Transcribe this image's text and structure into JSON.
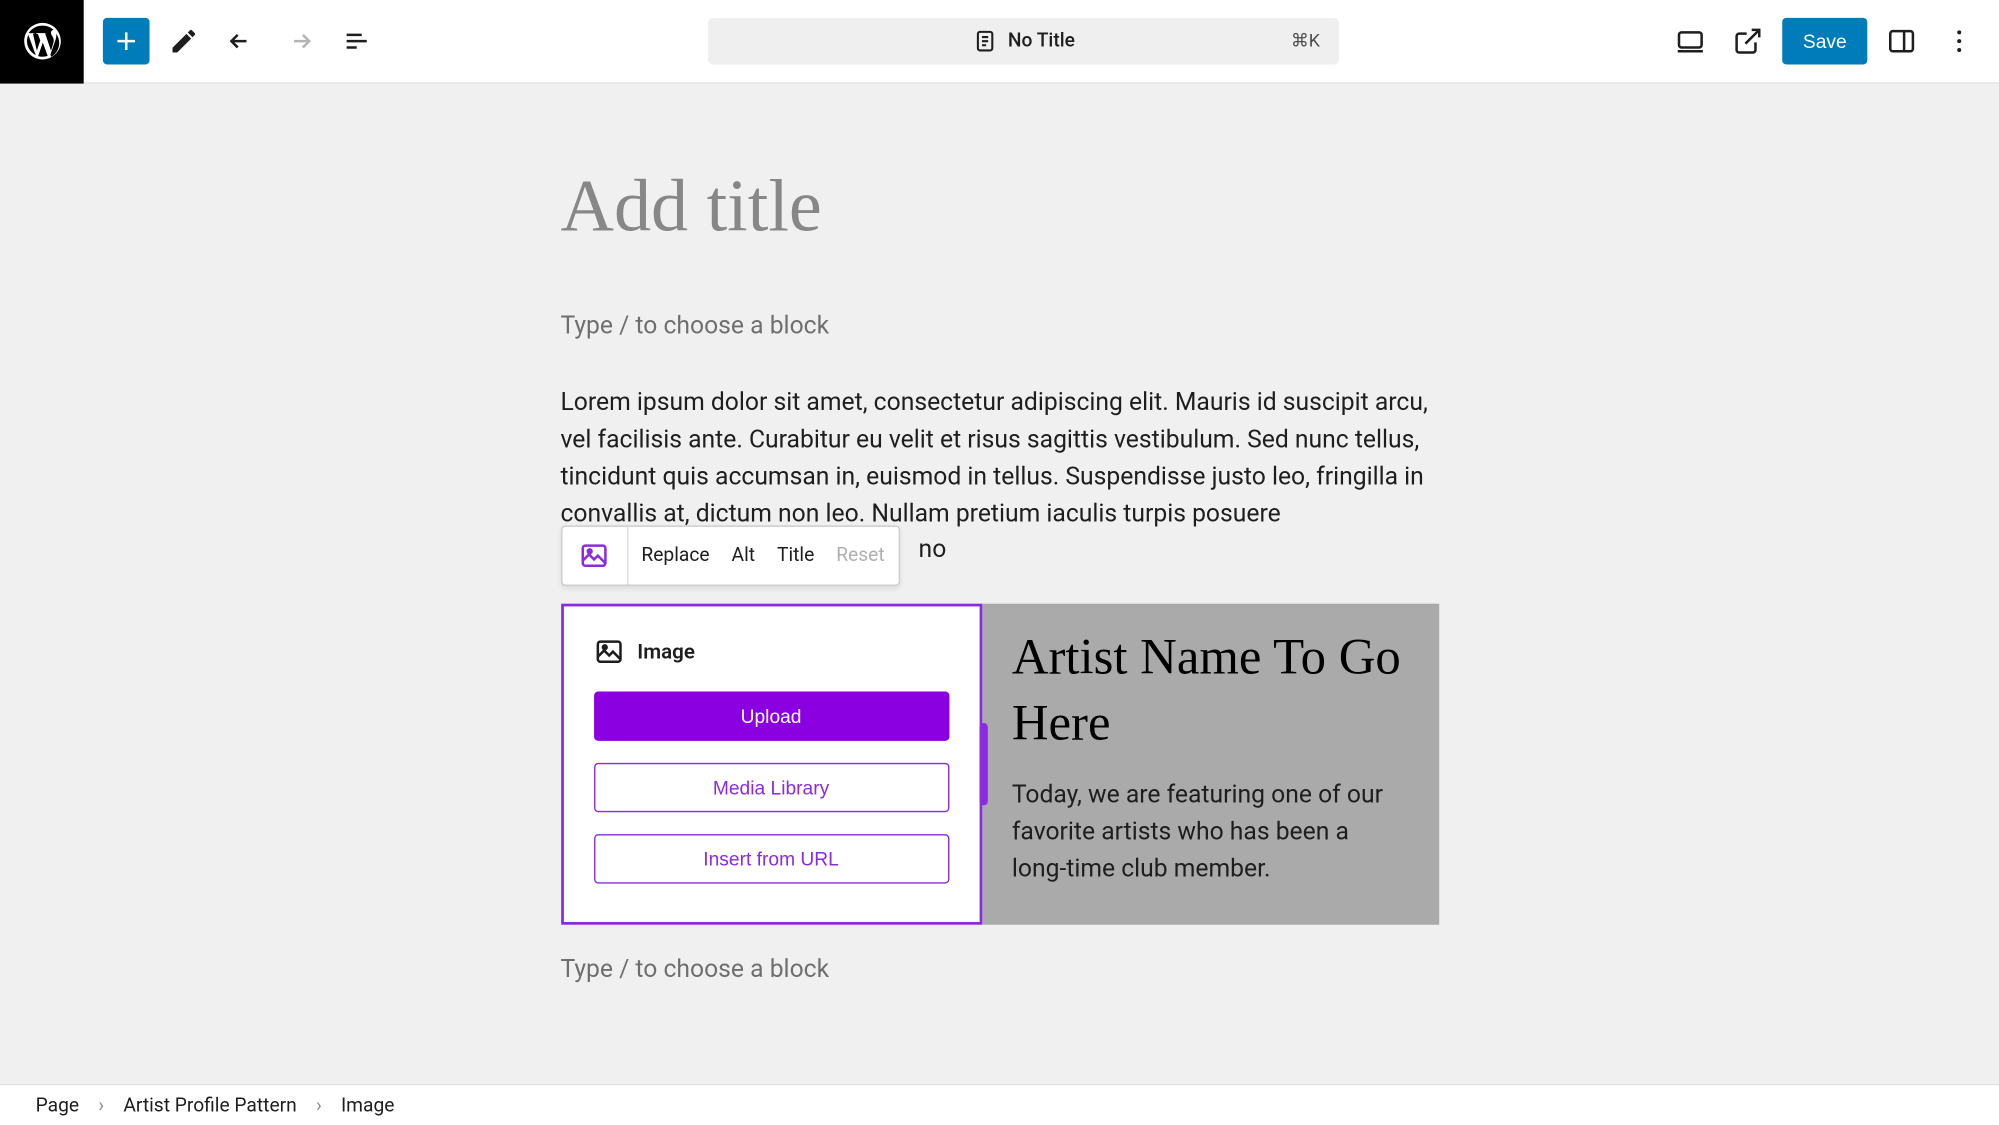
{
  "toolbar": {
    "title": "No Title",
    "kbd_shortcut": "⌘K",
    "save_label": "Save"
  },
  "content": {
    "title_placeholder": "Add title",
    "block_placeholder": "Type / to choose a block",
    "paragraph": "Lorem ipsum dolor sit amet, consectetur adipiscing elit. Mauris id suscipit arcu, vel facilisis ante. Curabitur eu velit et risus sagittis vestibulum. Sed nunc tellus, tincidunt quis accumsan in, euismod in tellus. Suspendisse justo leo, fringilla in convallis at, dictum non leo. Nullam pretium iaculis turpis posuere",
    "paragraph_trail": "no"
  },
  "block_toolbar": {
    "replace": "Replace",
    "alt": "Alt",
    "title": "Title",
    "reset": "Reset"
  },
  "image_placeholder": {
    "label": "Image",
    "upload": "Upload",
    "media_library": "Media Library",
    "insert_url": "Insert from URL"
  },
  "artist": {
    "title": "Artist Name To Go Here",
    "desc": "Today, we are featuring one of our favorite artists who has been a long-time club member."
  },
  "breadcrumb": {
    "item1": "Page",
    "item2": "Artist Profile Pattern",
    "item3": "Image",
    "sep": "›"
  }
}
